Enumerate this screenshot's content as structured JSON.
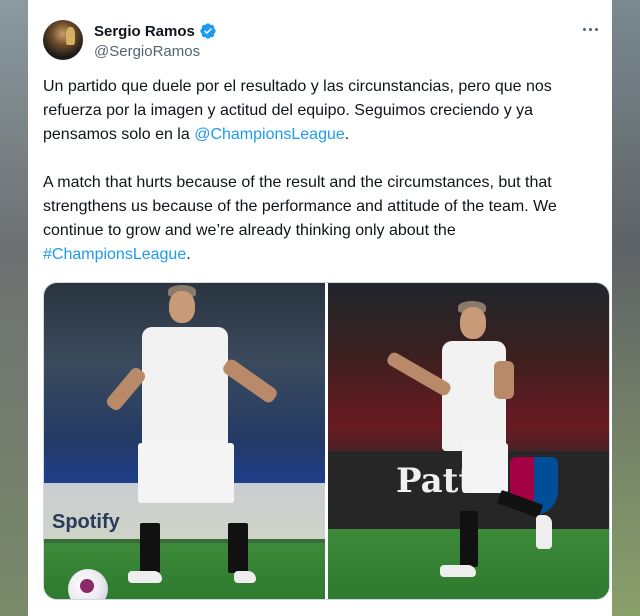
{
  "tweet": {
    "display_name": "Sergio Ramos",
    "handle": "@SergioRamos",
    "verified_icon": "verified-badge-icon",
    "more_icon": "more-options-icon",
    "text_es_part1": "Un partido que duele por el resultado y las circunstancias, pero que nos refuerza por la imagen y actitud del equipo. Seguimos creciendo y ya pensamos solo en la ",
    "mention": "@ChampionsLeague",
    "text_es_part2": ".",
    "text_en_part1": "A match that hurts because of the result and the circumstances, but that strengthens us because of the performance and attitude of the team. We continue to grow and we’re already thinking only about the ",
    "hashtag": "#ChampionsLeague",
    "text_en_part2": "."
  },
  "media": {
    "left_ad_text": "Spotify",
    "right_ad_text": "Patt"
  },
  "colors": {
    "link": "#1d9bf0",
    "verified": "#1d9bf0",
    "text": "#0f1419",
    "secondary_text": "#536471"
  }
}
